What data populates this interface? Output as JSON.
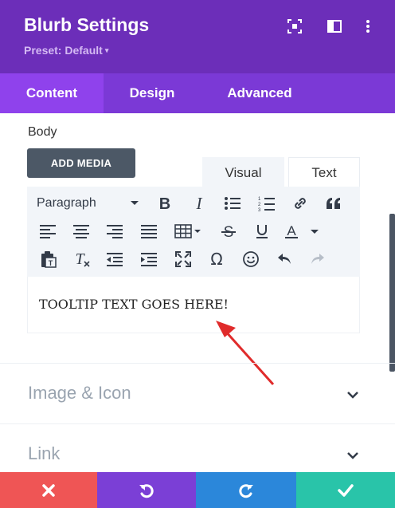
{
  "header": {
    "title": "Blurb Settings",
    "preset_label": "Preset: Default",
    "preset_caret": "▾",
    "icons": [
      "focus-icon",
      "sidebar-icon",
      "more-vertical-icon"
    ]
  },
  "tabs": [
    {
      "label": "Content",
      "active": true
    },
    {
      "label": "Design",
      "active": false
    },
    {
      "label": "Advanced",
      "active": false
    }
  ],
  "body_section": {
    "label": "Body",
    "add_media_label": "ADD MEDIA",
    "editor_tabs": {
      "visual": "Visual",
      "text": "Text"
    },
    "format_select": "Paragraph",
    "editor_content": "TOOLTIP TEXT GOES HERE!"
  },
  "sections": [
    {
      "label": "Image & Icon"
    },
    {
      "label": "Link"
    }
  ],
  "colors": {
    "header": "#6c2eb9",
    "tabs": "#7b39d6",
    "active_tab": "#8f42ec",
    "cancel": "#ef5555",
    "undo": "#7b3fd6",
    "redo": "#2b87da",
    "save": "#29c4a9",
    "annotation_arrow": "#e02b2b"
  }
}
